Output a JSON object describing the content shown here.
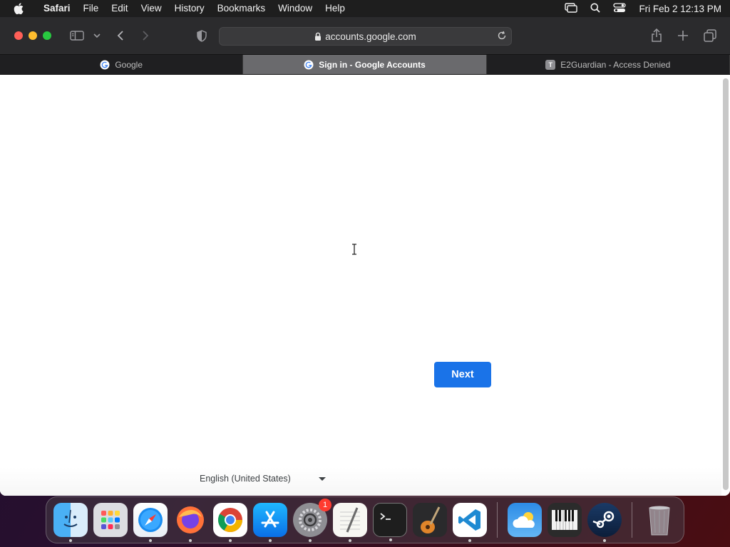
{
  "menubar": {
    "app": "Safari",
    "items": [
      "File",
      "Edit",
      "View",
      "History",
      "Bookmarks",
      "Window",
      "Help"
    ],
    "clock": "Fri Feb 2  12:13 PM"
  },
  "browser": {
    "url": "accounts.google.com",
    "tabs": [
      {
        "label": "Google",
        "favicon": "google-g-icon",
        "active": false
      },
      {
        "label": "Sign in - Google Accounts",
        "favicon": "google-g-icon",
        "active": true
      },
      {
        "label": "E2Guardian - Access Denied",
        "favicon": "T",
        "active": false
      }
    ]
  },
  "page": {
    "next_button": "Next",
    "language": "English (United States)",
    "accent_color": "#1a73e8"
  },
  "dock": {
    "badge_settings": "1",
    "apps": [
      "finder-icon",
      "launchpad-icon",
      "safari-icon",
      "firefox-icon",
      "chrome-icon",
      "app-store-icon",
      "system-settings-icon",
      "textedit-icon",
      "terminal-icon",
      "garageband-icon",
      "vscode-icon",
      "weather-icon",
      "piano-icon",
      "steam-icon",
      "trash-icon"
    ]
  }
}
